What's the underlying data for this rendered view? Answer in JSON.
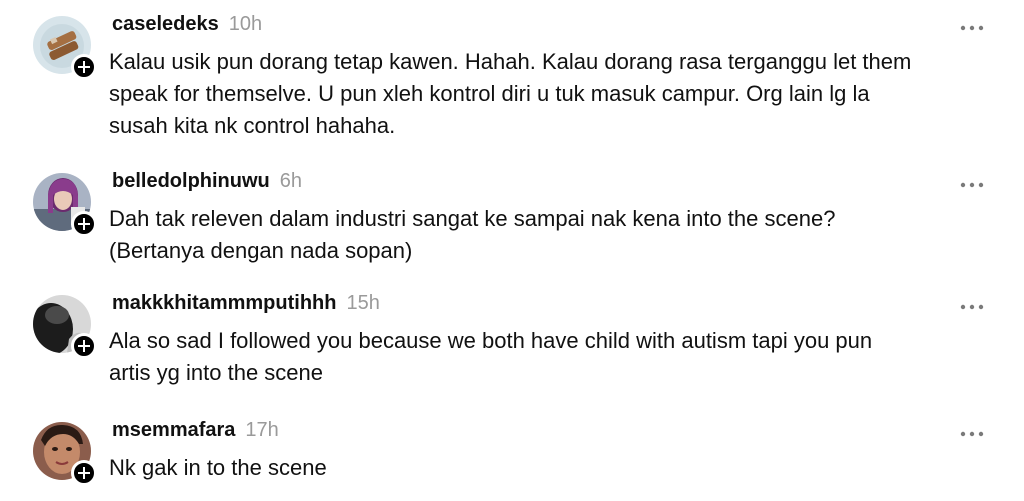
{
  "comments": [
    {
      "username": "caseledeks",
      "time": "10h",
      "lines": [
        "Kalau usik pun dorang tetap kawen. Hahah. Kalau dorang rasa terganggu let them",
        "speak for themselve. U pun xleh kontrol diri u tuk masuk campur. Org lain lg la",
        "susah kita nk control hahaha."
      ],
      "avatar_icon": "avatar-photo"
    },
    {
      "username": "belledolphinuwu",
      "time": "6h",
      "lines": [
        "Dah tak releven dalam industri sangat ke sampai nak kena into the scene?",
        "(Bertanya dengan nada sopan)"
      ],
      "avatar_icon": "avatar-photo"
    },
    {
      "username": "makkkhitammmputihhh",
      "time": "15h",
      "lines": [
        "Ala so sad I followed you because we both have child with autism tapi you pun",
        "artis yg into the scene"
      ],
      "avatar_icon": "avatar-photo"
    },
    {
      "username": "msemmafara",
      "time": "17h",
      "lines": [
        "Nk gak in to the scene"
      ],
      "avatar_icon": "avatar-photo"
    }
  ],
  "icons": {
    "follow": "plus-icon",
    "more": "more-options-icon"
  },
  "colors": {
    "text": "#111111",
    "timestamp": "#9a9a9a",
    "badge": "#000000"
  }
}
